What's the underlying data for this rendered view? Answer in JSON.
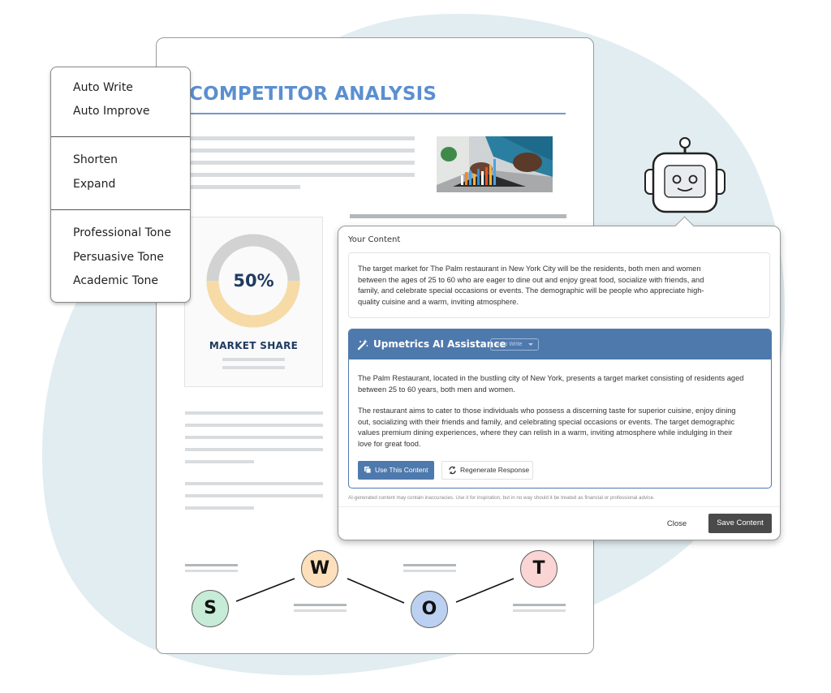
{
  "document": {
    "title": "COMPETITOR ANALYSIS",
    "market_share": {
      "value_label": "50%",
      "fraction": 0.5,
      "label": "MARKET SHARE",
      "colors": {
        "filled": "#f7dba6",
        "remaining": "#d2d2d2"
      }
    },
    "swot": [
      {
        "letter": "S",
        "color": "#c6ebd6"
      },
      {
        "letter": "W",
        "color": "#fde0bb"
      },
      {
        "letter": "O",
        "color": "#bcd1f1"
      },
      {
        "letter": "T",
        "color": "#fbd4d4"
      }
    ],
    "accent": "#5b8fd0"
  },
  "ai_menu": {
    "groups": [
      [
        "Auto Write",
        "Auto Improve"
      ],
      [
        "Shorten",
        "Expand"
      ],
      [
        "Professional Tone",
        "Persuasive Tone",
        "Academic Tone"
      ]
    ]
  },
  "dialog": {
    "your_content_label": "Your Content",
    "your_content_text": "The target market for The Palm restaurant in New York City will be the residents, both men and women between the ages of 25 to 60 who are eager to dine out and enjoy great food, socialize with friends, and family, and celebrate special occasions or events. The demographic will be people who appreciate high-quality cuisine and a warm, inviting atmosphere.",
    "ai_panel": {
      "title": "Upmetrics AI Assistance",
      "mode_select": "Auto Write",
      "paragraphs": [
        "The Palm Restaurant, located in the bustling city of New York, presents a target market consisting of residents aged between 25 to 60 years, both men and women.",
        "The restaurant aims to cater to those individuals who possess a discerning taste for superior cuisine, enjoy dining out, socializing with their friends and family, and celebrating special occasions or events. The target demographic values premium dining experiences, where they can relish in a warm, inviting atmosphere while indulging in their love for great food."
      ],
      "use_button": "Use This Content",
      "regenerate_button": "Regenerate Response",
      "header_color": "#4e79ad"
    },
    "disclaimer": "AI-generated content may contain inaccuracies. Use it for inspiration, but in no way should it be treated as financial or professional advice.",
    "close_button": "Close",
    "save_button": "Save Content"
  }
}
